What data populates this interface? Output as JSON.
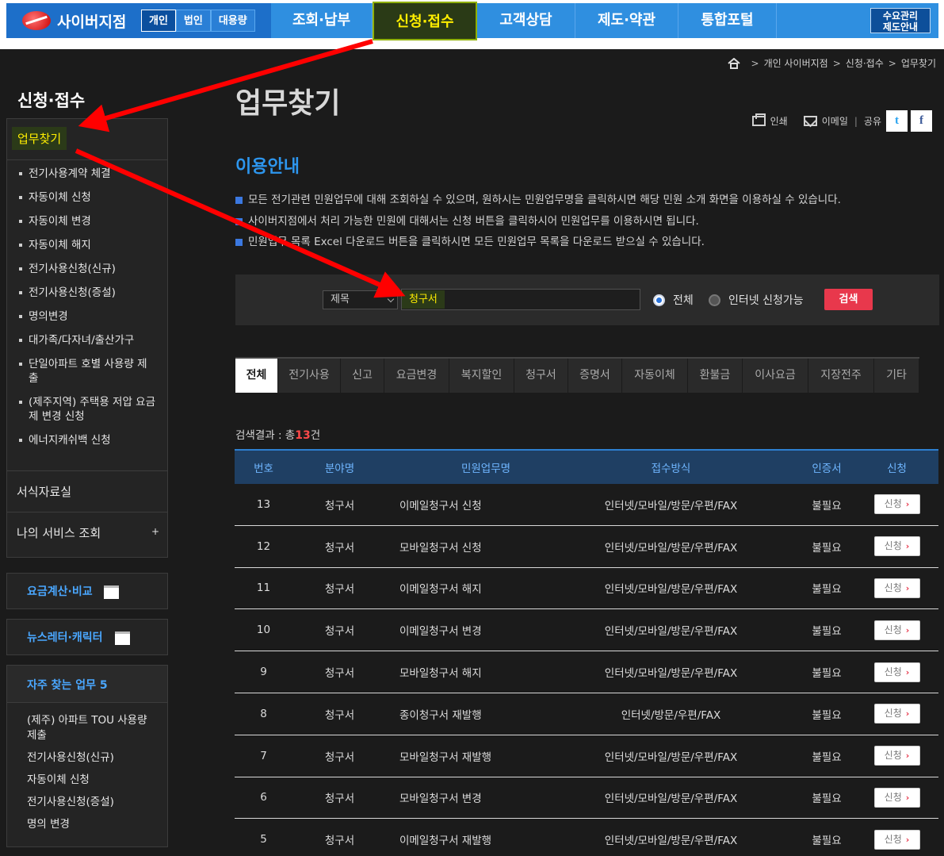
{
  "header": {
    "brand": "사이버지점",
    "type_tabs": [
      "개인",
      "법인",
      "대용량"
    ],
    "nav": [
      "조회·납부",
      "신청·접수",
      "고객상담",
      "제도·약관",
      "통합포털"
    ],
    "util_line1": "수요관리",
    "util_line2": "제도안내"
  },
  "breadcrumb": [
    "개인 사이버지점",
    "신청·접수",
    "업무찾기"
  ],
  "sidebar": {
    "title": "신청·접수",
    "active": "업무찾기",
    "subitems": [
      "전기사용계약 체결",
      "자동이체 신청",
      "자동이체 변경",
      "자동이체 해지",
      "전기사용신청(신규)",
      "전기사용신청(증설)",
      "명의변경",
      "대가족/다자녀/출산가구",
      "단일아파트 호별 사용량 제출",
      "(제주지역) 주택용 저압 요금제 변경 신청",
      "에너지캐쉬백 신청"
    ],
    "menu1": "서식자료실",
    "menu2": "나의 서비스 조회",
    "menu2_plus": "+",
    "box1": "요금계산·비교",
    "box2": "뉴스레터·캐릭터",
    "freq_title": "자주 찾는 업무 5",
    "freq_items": [
      "(제주) 아파트 TOU 사용량 제출",
      "전기사용신청(신규)",
      "자동이체 신청",
      "전기사용신청(증설)",
      "명의 변경"
    ]
  },
  "page": {
    "title": "업무찾기",
    "print": "인쇄",
    "email": "이메일",
    "share": "공유",
    "twitter": "t",
    "facebook": "f"
  },
  "guide": {
    "title": "이용안내",
    "lines": [
      "모든 전기관련 민원업무에 대해 조회하실 수 있으며, 원하시는 민원업무명을 클릭하시면 해당 민원 소개 화면을 이용하실 수 있습니다.",
      "사이버지점에서 처리 가능한 민원에 대해서는 신청 버튼을 클릭하시어 민원업무를 이용하시면 됩니다.",
      "민원업무 목록 Excel 다운로드 버튼을 클릭하시면 모든 민원업무 목록을 다운로드 받으실 수 있습니다."
    ]
  },
  "search": {
    "select_value": "제목",
    "input_value": "청구서",
    "radio_all": "전체",
    "radio_online": "인터넷 신청가능",
    "button": "검색"
  },
  "tabs": [
    "전체",
    "전기사용",
    "신고",
    "요금변경",
    "복지할인",
    "청구서",
    "증명서",
    "자동이체",
    "환불금",
    "이사요금",
    "지장전주",
    "기타"
  ],
  "result": {
    "prefix": "검색결과 : 총",
    "count": "13",
    "suffix": "건"
  },
  "table": {
    "headers": [
      "번호",
      "분야명",
      "민원업무명",
      "접수방식",
      "인증서",
      "신청"
    ],
    "apply_label": "신청",
    "rows": [
      {
        "no": "13",
        "field": "청구서",
        "name": "이메일청구서 신청",
        "method": "인터넷/모바일/방문/우편/FAX",
        "cert": "불필요"
      },
      {
        "no": "12",
        "field": "청구서",
        "name": "모바일청구서 신청",
        "method": "인터넷/모바일/방문/우편/FAX",
        "cert": "불필요"
      },
      {
        "no": "11",
        "field": "청구서",
        "name": "이메일청구서 해지",
        "method": "인터넷/모바일/방문/우편/FAX",
        "cert": "불필요"
      },
      {
        "no": "10",
        "field": "청구서",
        "name": "이메일청구서 변경",
        "method": "인터넷/모바일/방문/우편/FAX",
        "cert": "불필요"
      },
      {
        "no": "9",
        "field": "청구서",
        "name": "모바일청구서 해지",
        "method": "인터넷/모바일/방문/우편/FAX",
        "cert": "불필요"
      },
      {
        "no": "8",
        "field": "청구서",
        "name": "종이청구서 재발행",
        "method": "인터넷/방문/우편/FAX",
        "cert": "불필요"
      },
      {
        "no": "7",
        "field": "청구서",
        "name": "모바일청구서 재발행",
        "method": "인터넷/모바일/방문/우편/FAX",
        "cert": "불필요"
      },
      {
        "no": "6",
        "field": "청구서",
        "name": "모바일청구서 변경",
        "method": "인터넷/모바일/방문/우편/FAX",
        "cert": "불필요"
      },
      {
        "no": "5",
        "field": "청구서",
        "name": "이메일청구서 재발행",
        "method": "인터넷/모바일/방문/우편/FAX",
        "cert": "불필요"
      }
    ]
  },
  "colors": {
    "nav_blue": "#2f8fe0",
    "highlight_bg": "#2b3a18",
    "highlight_text": "#ffee00",
    "accent_red": "#e8384c",
    "arrow_red": "#ff0000",
    "link_blue": "#4aa7ff"
  }
}
